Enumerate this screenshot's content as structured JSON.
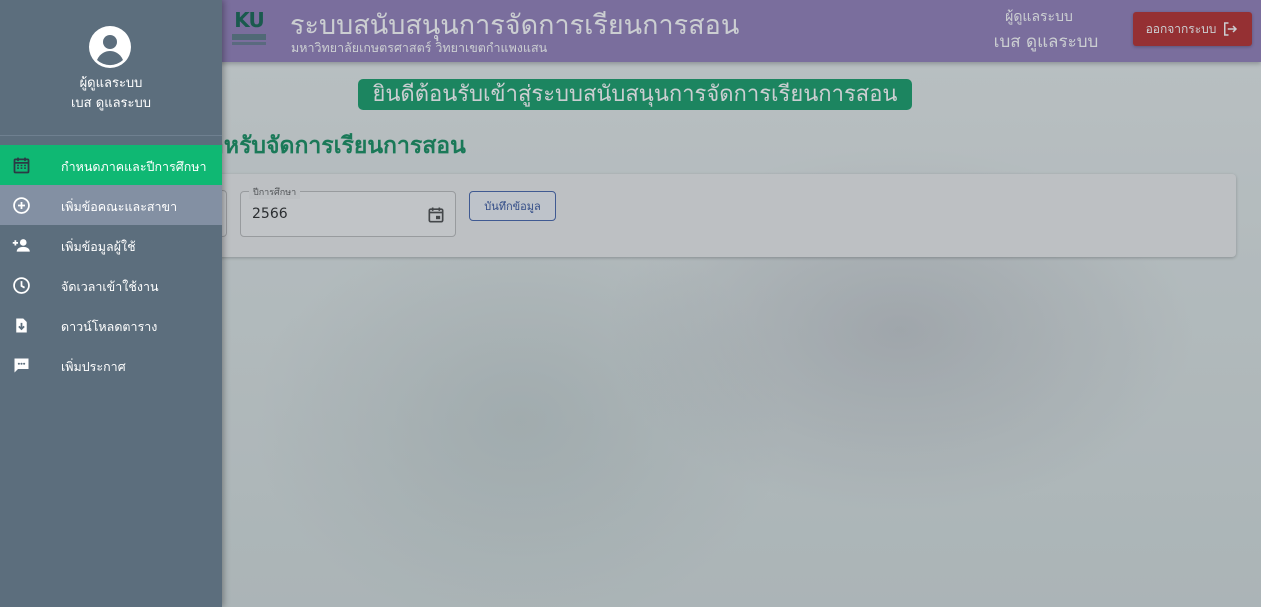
{
  "header": {
    "logo_text": "KU",
    "title": "ระบบสนับสนุนการจัดการเรียนการสอน",
    "subtitle": "มหาวิทยาลัยเกษตรศาสตร์ วิทยาเขตกำแพงแสน",
    "user_role": "ผู้ดูแลระบบ",
    "user_name": "เบส ดูแลระบบ",
    "logout_label": "ออกจากระบบ"
  },
  "main": {
    "welcome": "ยินดีต้อนรับเข้าสู่ระบบสนับสนุนการจัดการเรียนการสอน",
    "section_heading": "รศึกษา สำหรับจัดการเรียนการสอน",
    "year_field": {
      "label": "ปีการศึกษา",
      "value": "2566"
    },
    "save_label": "บันทึกข้อมูล"
  },
  "drawer": {
    "user_role": "ผู้ดูแลระบบ",
    "user_name": "เบส ดูแลระบบ",
    "items": [
      {
        "label": "กำหนดภาคและปีการศึกษา",
        "icon": "calendar-icon",
        "state": "active"
      },
      {
        "label": "เพิ่มข้อคณะและสาขา",
        "icon": "add-circle-icon",
        "state": "hover"
      },
      {
        "label": "เพิ่มข้อมูลผู้ใช้",
        "icon": "person-add-icon",
        "state": "normal"
      },
      {
        "label": "จัดเวลาเข้าใช้งาน",
        "icon": "clock-icon",
        "state": "normal"
      },
      {
        "label": "ดาวน์โหลดตาราง",
        "icon": "file-download-icon",
        "state": "normal"
      },
      {
        "label": "เพิ่มประกาศ",
        "icon": "chat-message-icon",
        "state": "normal"
      }
    ]
  },
  "colors": {
    "topbar": "#8f7ab8",
    "drawer": "#5c6e7d",
    "active_item": "#0fb873",
    "logout": "#b52525",
    "welcome_banner": "#0d9a63"
  }
}
